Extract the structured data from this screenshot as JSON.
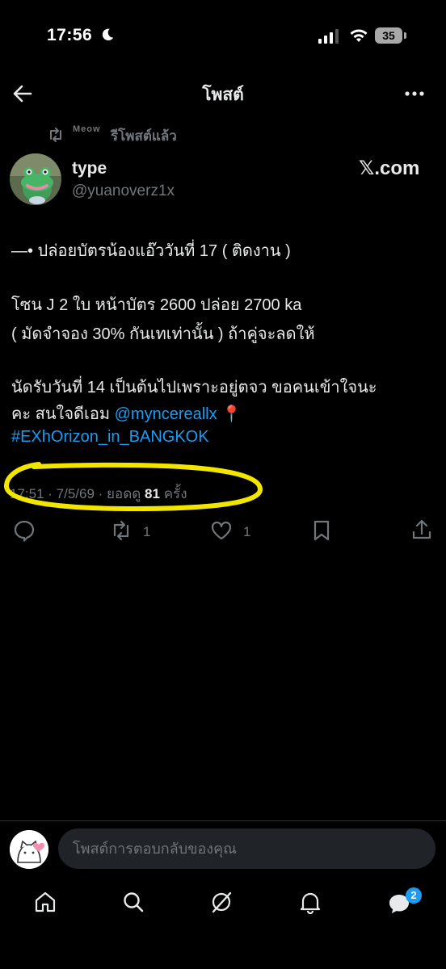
{
  "status_bar": {
    "time": "17:56",
    "battery": "35"
  },
  "header": {
    "title": "โพสต์"
  },
  "repost": {
    "meow": "Meow",
    "label": "รีโพสต์แล้ว"
  },
  "author": {
    "name": "type",
    "handle": "@yuanoverz1x",
    "source_label": "𝕏.com"
  },
  "post": {
    "line1": "—• ปล่อยบัตรน้องแอ๊ววันที่ 17 ( ติดงาน )",
    "line2": "โซน J 2 ใบ หน้าบัตร 2600 ปล่อย 2700 ka",
    "line3": "( มัดจำจอง 30% กันเทเท่านั้น ) ถ้าคู่จะลดให้",
    "line4": "นัดรับวันที่ 14 เป็นต้นไปเพราะอยู่ตจว ขอคนเข้าใจนะ",
    "line5_text": "คะ สนใจดีเอม ",
    "mention": "@myncereallx",
    "pin": "📍",
    "hashtag": "#EXhOrizon_in_BANGKOK"
  },
  "meta": {
    "time": "17:51",
    "date": "7/5/69",
    "views_label": "ยอดดู",
    "views": "81",
    "views_unit": "ครั้ง"
  },
  "actions": {
    "retweets": "1",
    "likes": "1"
  },
  "reply": {
    "placeholder": "โพสต์การตอบกลับของคุณ"
  },
  "nav": {
    "messages_badge": "2"
  },
  "colors": {
    "accent": "#1d9bf0",
    "muted": "#71767b",
    "annotation": "#f2e600"
  }
}
